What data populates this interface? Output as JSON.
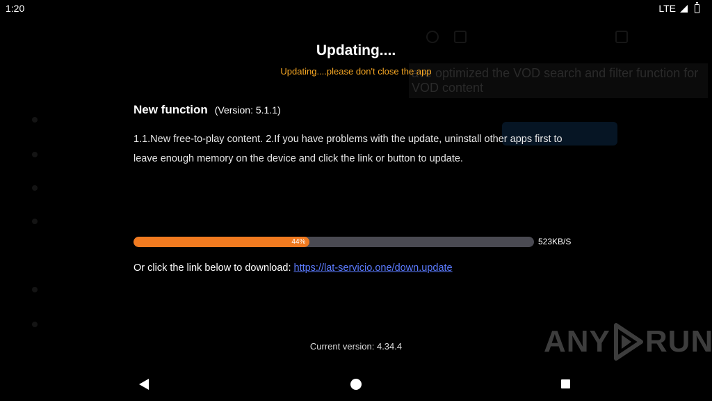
{
  "status_bar": {
    "time": "1:20",
    "network": "LTE"
  },
  "background": {
    "banner_text": "ave optimized the VOD search and filter function for VOD content"
  },
  "dialog": {
    "title": "Updating....",
    "subtitle": "Updating....please don't close the app",
    "function_title": "New function",
    "function_version": "(Version: 5.1.1)",
    "description": "1.1.New free-to-play content. 2.If you have problems with the update, uninstall other apps first to leave enough memory on the device and click the link or button to update.",
    "progress": {
      "percent": 44,
      "label": "44%"
    },
    "speed": "523KB/S",
    "link_prefix": "Or click the link below to download: ",
    "link_text": "https://lat-servicio.one/down.update",
    "current_version": "Current version: 4.34.4"
  },
  "watermark": {
    "left": "ANY",
    "right": "RUN"
  },
  "colors": {
    "accent": "#f07a20",
    "subtitle": "#f5a623",
    "link": "#5b7bff",
    "track": "#4a4a52"
  },
  "icons": [
    "back-icon",
    "home-icon",
    "recent-apps-icon",
    "signal-icon",
    "battery-icon",
    "play-logo-icon"
  ]
}
